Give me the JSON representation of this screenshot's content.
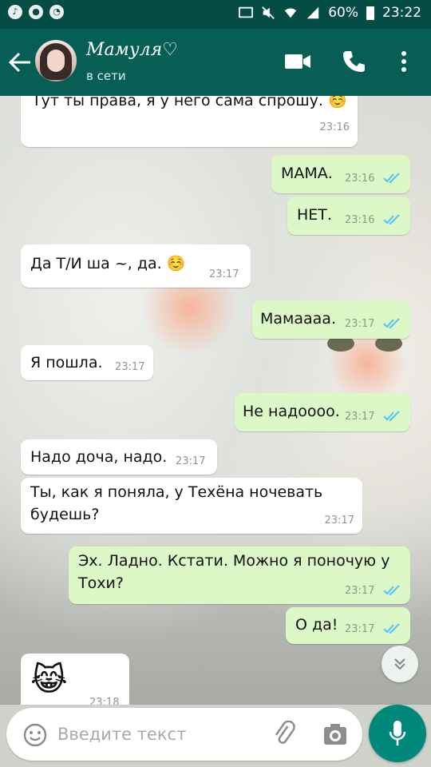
{
  "status_bar": {
    "battery": "60%",
    "time": "23:22"
  },
  "contact": {
    "name": "Мамуля♡",
    "status": "в сети"
  },
  "messages": [
    {
      "dir": "in",
      "text": "Тут ты права, я у него сама спрошу. ☺️",
      "time": "23:16"
    },
    {
      "dir": "out",
      "text": "МАМА.",
      "time": "23:16"
    },
    {
      "dir": "out",
      "text": "НЕТ.",
      "time": "23:16"
    },
    {
      "dir": "in",
      "text": "Да Т/И ша ~, да. ☺️",
      "time": "23:17"
    },
    {
      "dir": "out",
      "text": "Мамаааа.",
      "time": "23:17"
    },
    {
      "dir": "in",
      "text": "Я пошла.",
      "time": "23:17"
    },
    {
      "dir": "out",
      "text": "Не надоооо.",
      "time": "23:17"
    },
    {
      "dir": "in",
      "text": "Надо доча, надо.",
      "time": "23:17"
    },
    {
      "dir": "in",
      "text_line1": "Ты, как я поняла, у Техёна ночевать",
      "text_line2": "будешь?",
      "time": "23:17"
    },
    {
      "dir": "out",
      "text_line1": "Эх. Ладно. Кстати. Можно я поночую у",
      "text_line2": "Тохи?",
      "time": "23:17"
    },
    {
      "dir": "out",
      "text": "О да!",
      "time": "23:17"
    },
    {
      "dir": "in",
      "text": "😹",
      "time": "23:18"
    }
  ],
  "input": {
    "placeholder": "Введите текст"
  },
  "colors": {
    "header": "#075e54",
    "status_bar": "#054d44",
    "outgoing": "#dcf8c6",
    "incoming": "#ffffff",
    "read_tick": "#4fc3f7",
    "mic": "#00897b"
  }
}
